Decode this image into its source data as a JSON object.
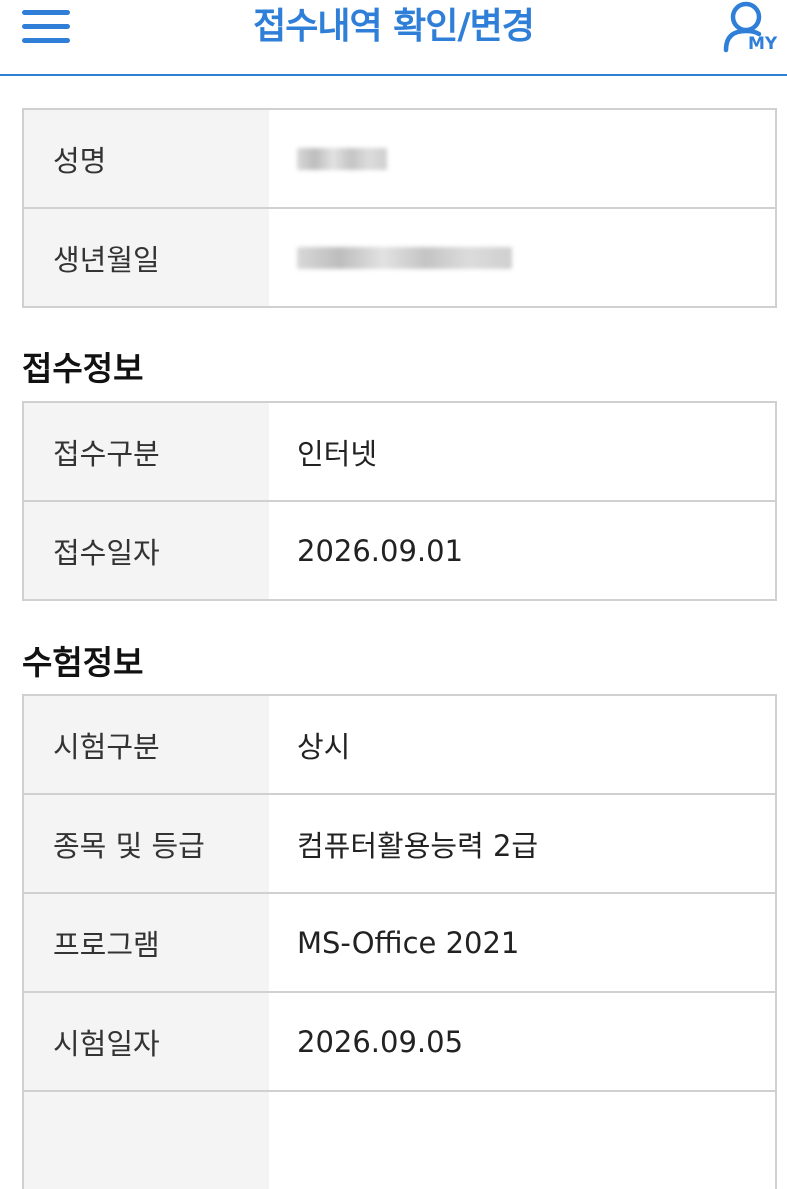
{
  "header": {
    "title": "접수내역 확인/변경",
    "my_label": "MY"
  },
  "applicant": {
    "rows": [
      {
        "label": "성명",
        "value": ""
      },
      {
        "label": "생년월일",
        "value": ""
      }
    ]
  },
  "receipt": {
    "title": "접수정보",
    "rows": [
      {
        "label": "접수구분",
        "value": "인터넷"
      },
      {
        "label": "접수일자",
        "value": "2026.09.01"
      }
    ]
  },
  "exam": {
    "title": "수험정보",
    "rows": [
      {
        "label": "시험구분",
        "value": "상시"
      },
      {
        "label": "종목 및 등급",
        "value": "컴퓨터활용능력 2급"
      },
      {
        "label": "프로그램",
        "value": "MS-Office 2021"
      },
      {
        "label": "시험일자",
        "value": "2026.09.05"
      },
      {
        "label": "",
        "value": ""
      }
    ]
  },
  "colors": {
    "accent": "#2f7fd8",
    "label_bg": "#f4f4f4",
    "border": "#d0d0d0"
  }
}
